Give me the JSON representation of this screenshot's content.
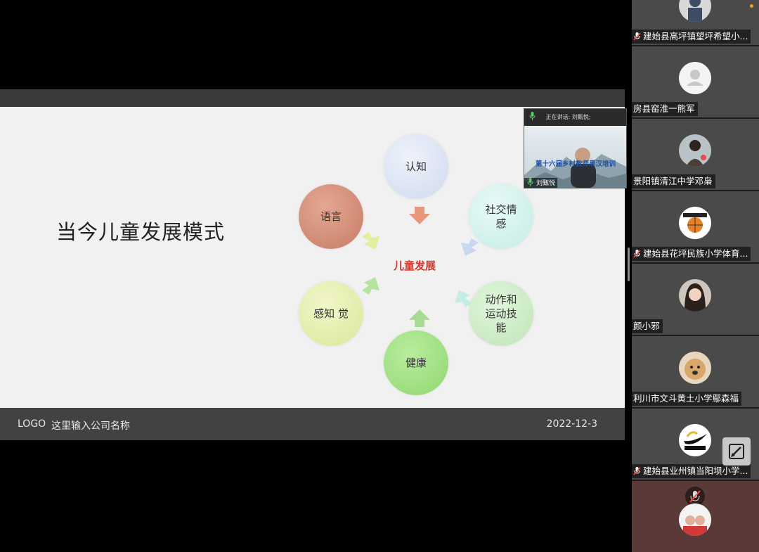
{
  "slide": {
    "title": "当今儿童发展模式",
    "center_label": "儿童发展",
    "nodes": {
      "cognition": "认知",
      "language": "语言",
      "social_1": "社交情",
      "social_2": "感",
      "perception": "感知 觉",
      "motor_1": "动作和",
      "motor_2": "运动技",
      "motor_3": "能",
      "health": "健康"
    },
    "footer": {
      "logo": "LOGO",
      "company": "这里输入公司名称",
      "date": "2022-12-3"
    }
  },
  "speaker_pip": {
    "speaking_prefix": "正在讲话: 刘甄悦;",
    "banner": "第十六届乡村教师果汉培训",
    "name": "刘甄悦"
  },
  "participants": [
    {
      "name": "建始县高坪镇望坪希望小...",
      "muted": true
    },
    {
      "name": "房县窑淮一熊军",
      "muted": false
    },
    {
      "name": "景阳镇清江中学邓枭",
      "muted": false
    },
    {
      "name": "建始县花坪民族小学体育...",
      "muted": true
    },
    {
      "name": "颜小邪",
      "muted": false
    },
    {
      "name": "利川市文斗黄土小学鄢森福",
      "muted": false
    },
    {
      "name": "建始县业州镇当阳坝小学...",
      "muted": true
    }
  ],
  "colors": {
    "accent_red": "#d9362b",
    "slide_bg": "#f1f1f1",
    "footer_bg": "#424242"
  }
}
